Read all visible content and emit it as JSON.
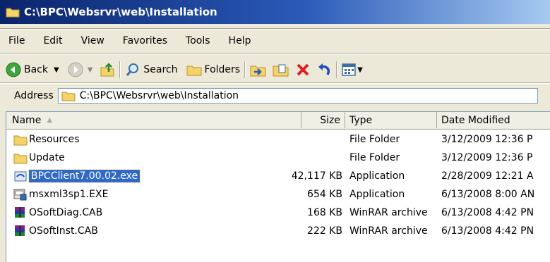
{
  "window": {
    "title": "C:\\BPC\\Websrvr\\web\\Installation"
  },
  "menu": {
    "file": "File",
    "edit": "Edit",
    "view": "View",
    "favorites": "Favorites",
    "tools": "Tools",
    "help": "Help"
  },
  "toolbar": {
    "back": "Back",
    "search": "Search",
    "folders": "Folders"
  },
  "address": {
    "label": "Address",
    "value": "C:\\BPC\\Websrvr\\web\\Installation"
  },
  "columns": {
    "name": "Name",
    "size": "Size",
    "type": "Type",
    "date": "Date Modified"
  },
  "files": [
    {
      "name": "Resources",
      "size": "",
      "type": "File Folder",
      "date": "3/12/2009 12:36 P",
      "icon": "folder-icon"
    },
    {
      "name": "Update",
      "size": "",
      "type": "File Folder",
      "date": "3/12/2009 12:36 P",
      "icon": "folder-icon"
    },
    {
      "name": "BPCClient7.00.02.exe",
      "size": "42,117 KB",
      "type": "Application",
      "date": "2/28/2009 12:21 A",
      "icon": "exe-icon",
      "selected": true
    },
    {
      "name": "msxml3sp1.EXE",
      "size": "654 KB",
      "type": "Application",
      "date": "6/13/2008 8:00 AN",
      "icon": "installer-icon"
    },
    {
      "name": "OSoftDiag.CAB",
      "size": "168 KB",
      "type": "WinRAR archive",
      "date": "6/13/2008 4:42 PN",
      "icon": "winrar-icon"
    },
    {
      "name": "OSoftInst.CAB",
      "size": "222 KB",
      "type": "WinRAR archive",
      "date": "6/13/2008 4:42 PN",
      "icon": "winrar-icon"
    }
  ],
  "colors": {
    "selection": "#316ac5",
    "titlebar": "#0a246a",
    "chrome": "#ece9d8"
  }
}
